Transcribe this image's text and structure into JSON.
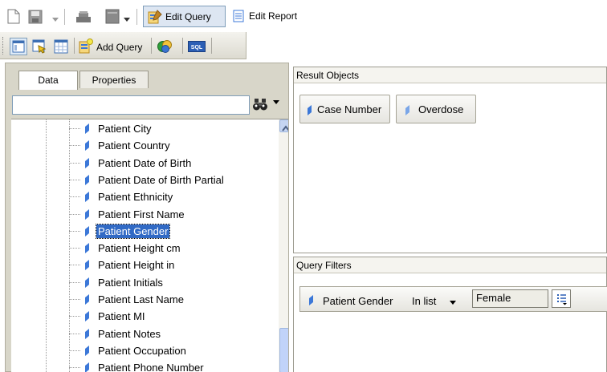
{
  "toolbar": {
    "edit_query_label": "Edit Query",
    "edit_report_label": "Edit Report"
  },
  "toolbar2": {
    "add_query_label": "Add Query",
    "sql_label": "SQL"
  },
  "left_panel": {
    "tabs": [
      {
        "label": "Data",
        "active": true
      },
      {
        "label": "Properties",
        "active": false
      }
    ],
    "search": {
      "value": "",
      "placeholder": ""
    },
    "tree_items": [
      {
        "label": "Patient City",
        "selected": false
      },
      {
        "label": "Patient Country",
        "selected": false
      },
      {
        "label": "Patient Date of Birth",
        "selected": false
      },
      {
        "label": "Patient Date of Birth Partial",
        "selected": false
      },
      {
        "label": "Patient Ethnicity",
        "selected": false
      },
      {
        "label": "Patient First Name",
        "selected": false
      },
      {
        "label": "Patient Gender",
        "selected": true
      },
      {
        "label": "Patient Height cm",
        "selected": false
      },
      {
        "label": "Patient Height in",
        "selected": false
      },
      {
        "label": "Patient Initials",
        "selected": false
      },
      {
        "label": "Patient Last Name",
        "selected": false
      },
      {
        "label": "Patient MI",
        "selected": false
      },
      {
        "label": "Patient Notes",
        "selected": false
      },
      {
        "label": "Patient Occupation",
        "selected": false
      },
      {
        "label": "Patient Phone Number",
        "selected": false
      }
    ]
  },
  "result_objects": {
    "title": "Result Objects",
    "items": [
      {
        "label": "Case Number"
      },
      {
        "label": "Overdose"
      }
    ]
  },
  "query_filters": {
    "title": "Query Filters",
    "filter": {
      "field": "Patient Gender",
      "operator": "In list",
      "value": "Female"
    }
  },
  "colors": {
    "selection": "#316ac5",
    "object_icon": "#3c78d8",
    "panel_bg": "#d8d6c9"
  }
}
